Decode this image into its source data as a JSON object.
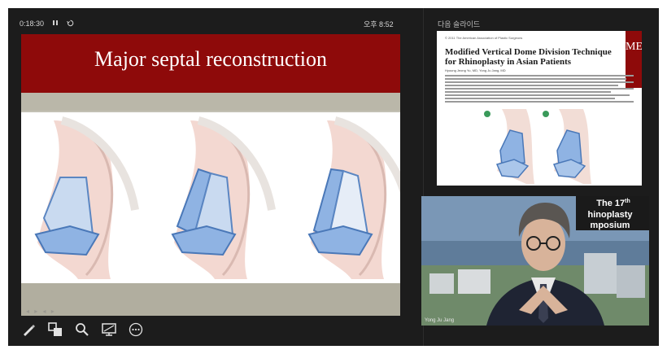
{
  "presenter": {
    "elapsed": "0:18:30",
    "pause_icon": "pause-icon",
    "reset_icon": "reset-icon",
    "clock": "오후 8:52",
    "next_label": "다음 슬라이드"
  },
  "current_slide": {
    "title": "Major septal reconstruction",
    "colors": {
      "header": "#8e0a0a",
      "background": "#c3c1b4"
    }
  },
  "next_slide": {
    "journal_meta": "© 2011 The American Association of Plastic Surgeons",
    "paper_title": "Modified Vertical Dome Division Technique for Rhinoplasty in Asian Patients",
    "authors": "Hyoung Jeong Yu, MD, Yong Ju Jang, MD",
    "edge_text": "ME"
  },
  "toolbar": {
    "items": [
      {
        "name": "pen-icon"
      },
      {
        "name": "slides-grid-icon"
      },
      {
        "name": "zoom-icon"
      },
      {
        "name": "screen-icon"
      },
      {
        "name": "more-icon"
      }
    ]
  },
  "webcam": {
    "banner_line1": "The 17",
    "banner_sup": "th",
    "banner_line2": "hinoplasty",
    "banner_line3": "mposium",
    "name_tag": "Yong Ju Jang"
  }
}
